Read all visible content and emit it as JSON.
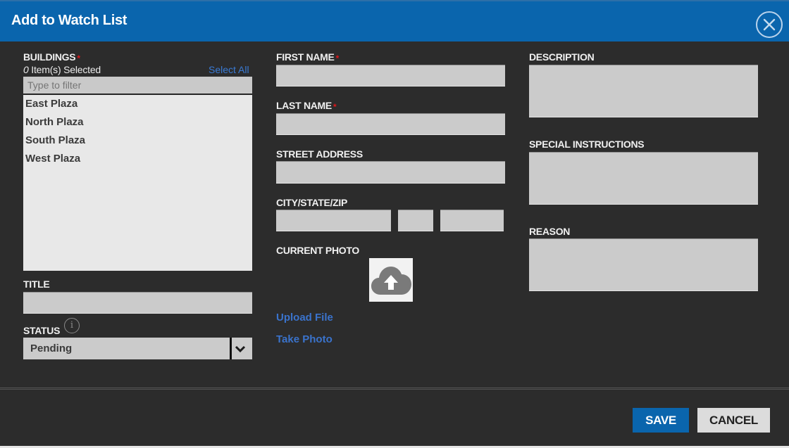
{
  "dialog": {
    "title": "Add to Watch List",
    "close_icon": "close-circle-icon"
  },
  "buildings": {
    "label": "BUILDINGS",
    "required_marker": "*",
    "selected_count": "0",
    "selected_suffix": " Item(s) Selected",
    "select_all_label": "Select All",
    "filter_placeholder": "Type to filter",
    "filter_value": "",
    "items": [
      {
        "label": "East Plaza"
      },
      {
        "label": "North Plaza"
      },
      {
        "label": "South Plaza"
      },
      {
        "label": "West Plaza"
      }
    ]
  },
  "title_field": {
    "label": "TITLE",
    "value": ""
  },
  "status_field": {
    "label": "STATUS",
    "value": "Pending",
    "info_icon": "info-icon"
  },
  "first_name": {
    "label": "FIRST NAME",
    "required_marker": "*",
    "value": ""
  },
  "last_name": {
    "label": "LAST NAME",
    "required_marker": "*",
    "value": ""
  },
  "street_address": {
    "label": "STREET ADDRESS",
    "value": ""
  },
  "city_state_zip": {
    "label": "CITY/STATE/ZIP",
    "city": "",
    "state": "",
    "zip": ""
  },
  "photo": {
    "label": "CURRENT PHOTO",
    "upload_icon": "cloud-upload-icon",
    "upload_file_label": "Upload File",
    "take_photo_label": "Take Photo"
  },
  "description": {
    "label": "DESCRIPTION",
    "value": ""
  },
  "special_instructions": {
    "label": "SPECIAL INSTRUCTIONS",
    "value": ""
  },
  "reason": {
    "label": "REASON",
    "value": ""
  },
  "footer": {
    "save_label": "SAVE",
    "cancel_label": "CANCEL"
  },
  "colors": {
    "header": "#0a65ad",
    "body": "#2c2c2c",
    "field": "#cbcbcb",
    "link": "#3a73cc",
    "required": "#e0161a"
  }
}
